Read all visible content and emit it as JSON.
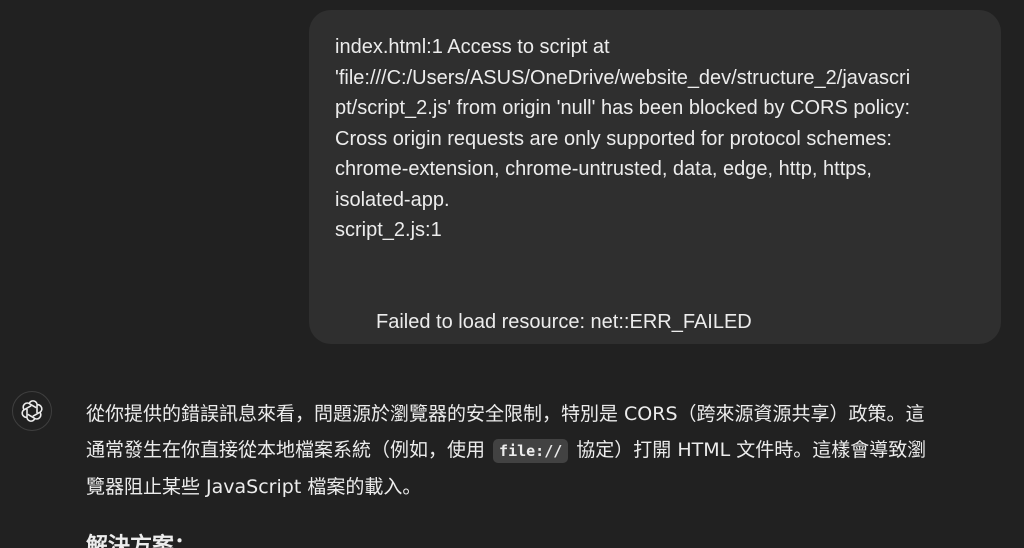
{
  "user_message": {
    "lines": [
      "index.html:1  Access to script at",
      "'file:///C:/Users/ASUS/OneDrive/website_dev/structure_2/javascri",
      "pt/script_2.js' from origin 'null' has been blocked by CORS policy:",
      "Cross origin requests are only supported for protocol schemes:",
      "chrome-extension, chrome-untrusted, data, edge, http, https,",
      "isolated-app.",
      "script_2.js:1"
    ],
    "last_line": "Failed to load resource: net::ERR_FAILED"
  },
  "assistant": {
    "avatar_icon": "openai-logo-icon",
    "line1": "從你提供的錯誤訊息來看，問題源於瀏覽器的安全限制，特別是 CORS（跨來源資源共享）政策。這",
    "line2_before": "通常發生在你直接從本地檔案系統（例如，使用 ",
    "line2_code": "file://",
    "line2_after": " 協定）打開 HTML 文件時。這樣會導致瀏",
    "line3": "覽器阻止某些 JavaScript 檔案的載入。",
    "heading": "解決方案："
  }
}
